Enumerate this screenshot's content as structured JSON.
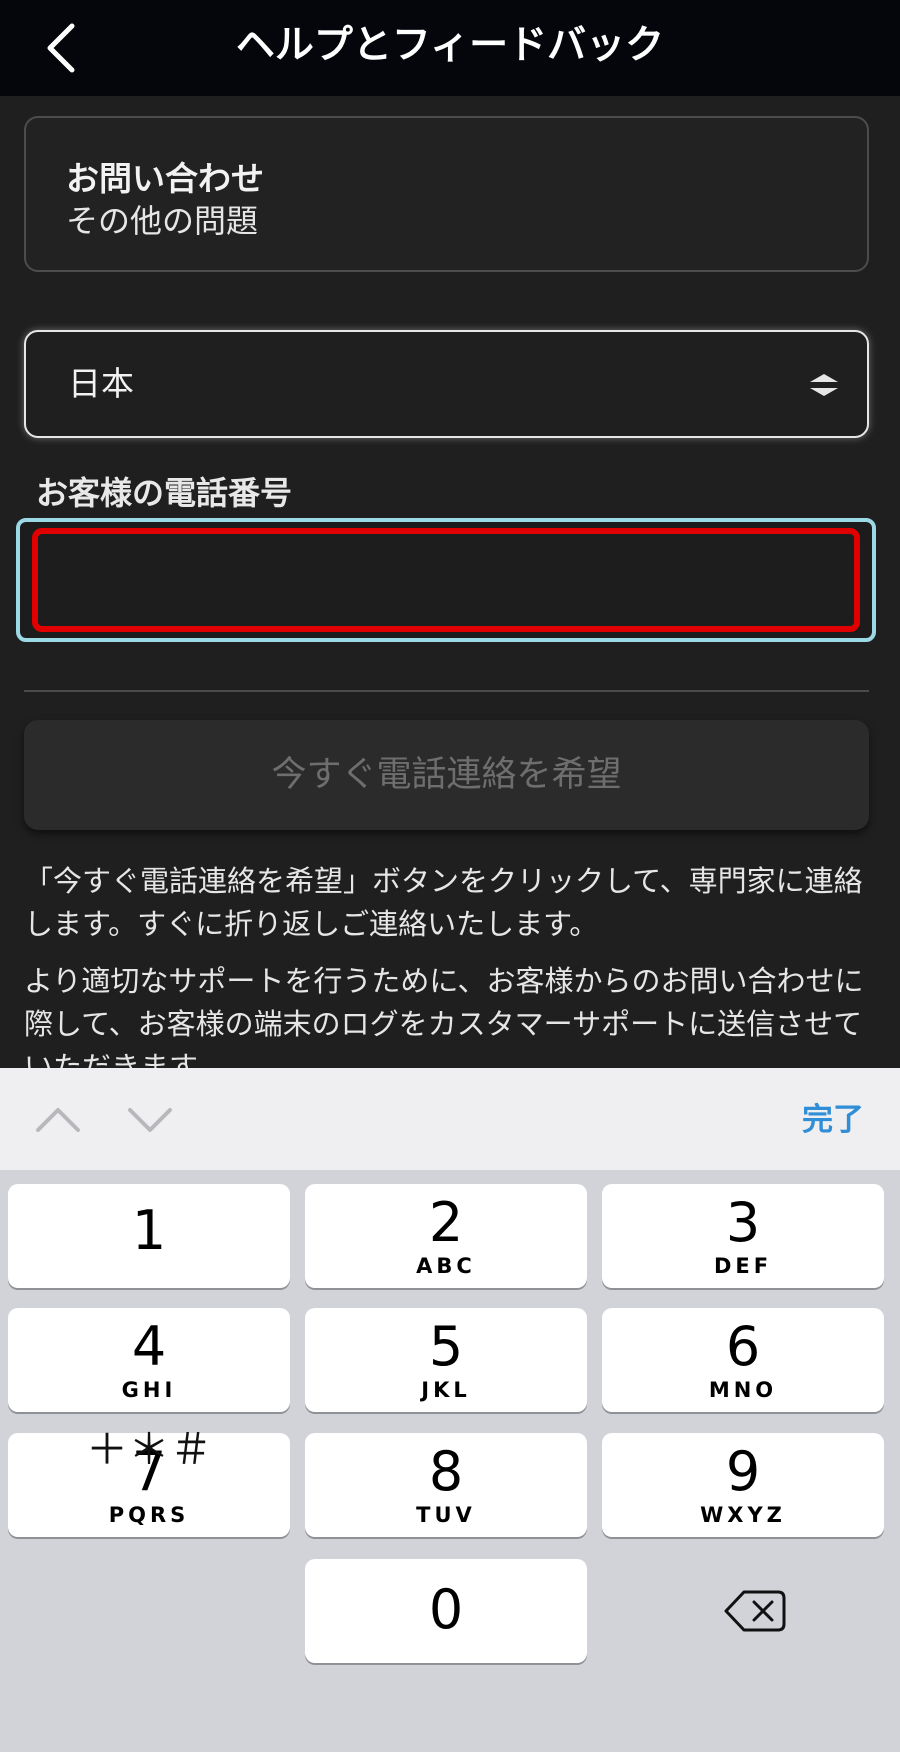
{
  "header": {
    "title": "ヘルプとフィードバック"
  },
  "contact": {
    "title": "お問い合わせ",
    "subtitle": "その他の問題"
  },
  "country": {
    "selected": "日本"
  },
  "phone": {
    "label": "お客様の電話番号",
    "value": ""
  },
  "call_button": {
    "label": "今すぐ電話連絡を希望"
  },
  "info": {
    "paragraph1": "「今すぐ電話連絡を希望」ボタンをクリックして、専門家に連絡します。すぐに折り返しご連絡いたします。",
    "paragraph2": "より適切なサポートを行うために、お客様からのお問い合わせに際して、お客様の端末のログをカスタマーサポートに送信させていただきます。"
  },
  "keyboard": {
    "done_label": "完了",
    "keys": [
      {
        "num": "1",
        "letters": ""
      },
      {
        "num": "2",
        "letters": "ABC"
      },
      {
        "num": "3",
        "letters": "DEF"
      },
      {
        "num": "4",
        "letters": "GHI"
      },
      {
        "num": "5",
        "letters": "JKL"
      },
      {
        "num": "6",
        "letters": "MNO"
      },
      {
        "num": "7",
        "letters": "PQRS"
      },
      {
        "num": "8",
        "letters": "TUV"
      },
      {
        "num": "9",
        "letters": "WXYZ"
      },
      {
        "num": "0",
        "letters": ""
      }
    ],
    "symbols_label": "＋＊＃"
  },
  "colors": {
    "accent": "#2f8ed6",
    "error_border": "#e10000",
    "focus_ring": "#9bd9e6"
  }
}
